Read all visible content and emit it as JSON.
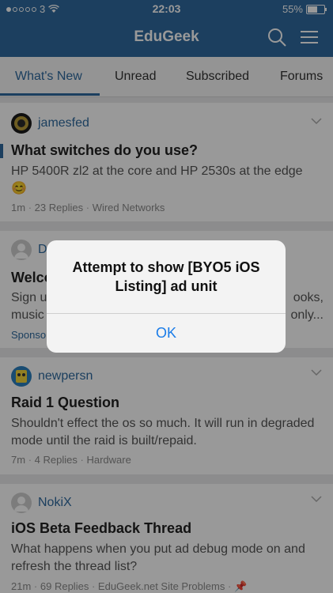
{
  "status_bar": {
    "carrier": "3",
    "time": "22:03",
    "battery": "55%",
    "signal_level": 1,
    "battery_level": 0.55
  },
  "nav": {
    "title": "EduGeek",
    "search_icon": "search-icon",
    "menu_icon": "hamburger-menu-icon"
  },
  "tabs": [
    {
      "label": "What's New",
      "active": true
    },
    {
      "label": "Unread"
    },
    {
      "label": "Subscribed"
    },
    {
      "label": "Forums"
    }
  ],
  "posts": [
    {
      "author": "jamesfed",
      "title": "What switches do you use?",
      "snippet": "HP 5400R zl2 at the core and HP 2530s at the edge",
      "emoji": "😊",
      "time": "1m",
      "replies": "23 Replies",
      "forum": "Wired Networks"
    },
    {
      "author": "D",
      "title": "Welco",
      "snippet_line1_left": "Sign u",
      "snippet_line1_right": "ooks,",
      "snippet_line2_left": "music",
      "snippet_line2_right": "only...",
      "sponsor": "Sponso"
    },
    {
      "author": "newpersn",
      "title": "Raid 1 Question",
      "snippet": "Shouldn't effect the os so much. It will run in degraded mode until the raid is built/repaid.",
      "time": "7m",
      "replies": "4 Replies",
      "forum": "Hardware"
    },
    {
      "author": "NokiX",
      "title": "iOS Beta Feedback Thread",
      "snippet": "What happens when you put ad debug mode on and refresh the thread list?",
      "time": "21m",
      "replies": "69 Replies",
      "forum": "EduGeek.net Site Problems"
    }
  ],
  "alert": {
    "message": "Attempt to show [BYO5 iOS Listing] ad unit",
    "ok_label": "OK"
  },
  "colors": {
    "brand": "#2f6a9e",
    "link": "#1a7ce8"
  }
}
